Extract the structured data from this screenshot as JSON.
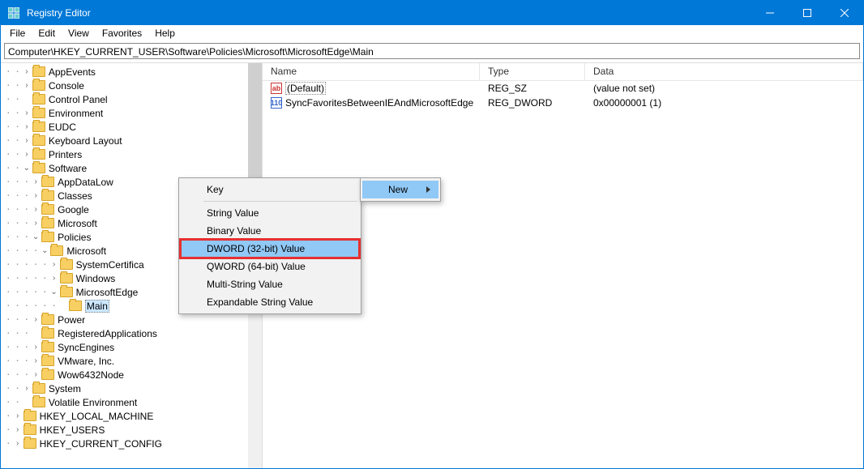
{
  "window": {
    "title": "Registry Editor"
  },
  "menubar": [
    "File",
    "Edit",
    "View",
    "Favorites",
    "Help"
  ],
  "address": "Computer\\HKEY_CURRENT_USER\\Software\\Policies\\Microsoft\\MicrosoftEdge\\Main",
  "tree": [
    {
      "d": 3,
      "e": ">",
      "l": "AppEvents"
    },
    {
      "d": 3,
      "e": ">",
      "l": "Console"
    },
    {
      "d": 3,
      "e": " ",
      "l": "Control Panel"
    },
    {
      "d": 3,
      "e": ">",
      "l": "Environment"
    },
    {
      "d": 3,
      "e": ">",
      "l": "EUDC"
    },
    {
      "d": 3,
      "e": ">",
      "l": "Keyboard Layout"
    },
    {
      "d": 3,
      "e": ">",
      "l": "Printers"
    },
    {
      "d": 3,
      "e": "v",
      "l": "Software"
    },
    {
      "d": 4,
      "e": ">",
      "l": "AppDataLow"
    },
    {
      "d": 4,
      "e": ">",
      "l": "Classes"
    },
    {
      "d": 4,
      "e": ">",
      "l": "Google"
    },
    {
      "d": 4,
      "e": ">",
      "l": "Microsoft"
    },
    {
      "d": 4,
      "e": "v",
      "l": "Policies"
    },
    {
      "d": 5,
      "e": "v",
      "l": "Microsoft"
    },
    {
      "d": 6,
      "e": ">",
      "l": "SystemCertifica"
    },
    {
      "d": 6,
      "e": ">",
      "l": "Windows"
    },
    {
      "d": 6,
      "e": "v",
      "l": "MicrosoftEdge"
    },
    {
      "d": 7,
      "e": " ",
      "l": "Main",
      "sel": true
    },
    {
      "d": 4,
      "e": ">",
      "l": "Power"
    },
    {
      "d": 4,
      "e": " ",
      "l": "RegisteredApplications"
    },
    {
      "d": 4,
      "e": ">",
      "l": "SyncEngines"
    },
    {
      "d": 4,
      "e": ">",
      "l": "VMware, Inc."
    },
    {
      "d": 4,
      "e": ">",
      "l": "Wow6432Node"
    },
    {
      "d": 3,
      "e": ">",
      "l": "System"
    },
    {
      "d": 3,
      "e": " ",
      "l": "Volatile Environment"
    },
    {
      "d": 2,
      "e": ">",
      "l": "HKEY_LOCAL_MACHINE"
    },
    {
      "d": 2,
      "e": ">",
      "l": "HKEY_USERS"
    },
    {
      "d": 2,
      "e": ">",
      "l": "HKEY_CURRENT_CONFIG"
    }
  ],
  "columns": {
    "name": "Name",
    "type": "Type",
    "data": "Data"
  },
  "values": [
    {
      "icon": "ab",
      "name": "(Default)",
      "type": "REG_SZ",
      "data": "(value not set)",
      "first": true
    },
    {
      "icon": "nm",
      "name": "SyncFavoritesBetweenIEAndMicrosoftEdge",
      "type": "REG_DWORD",
      "data": "0x00000001 (1)"
    }
  ],
  "context": {
    "main_item": "New",
    "sub": [
      {
        "l": "Key",
        "sep": true
      },
      {
        "l": "String Value"
      },
      {
        "l": "Binary Value"
      },
      {
        "l": "DWORD (32-bit) Value",
        "hi": true
      },
      {
        "l": "QWORD (64-bit) Value"
      },
      {
        "l": "Multi-String Value"
      },
      {
        "l": "Expandable String Value"
      }
    ]
  }
}
